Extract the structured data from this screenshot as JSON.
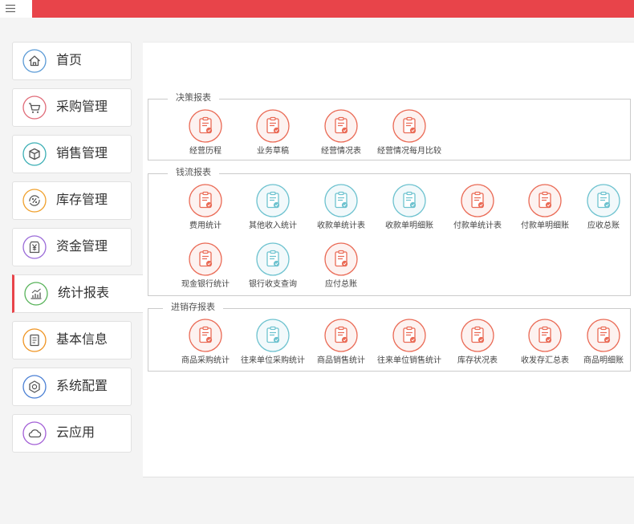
{
  "menu_button": {
    "icon": "hamburger-icon"
  },
  "header": {
    "accent_color": "#e8444a"
  },
  "sidebar": {
    "items": [
      {
        "label": "首页",
        "icon": "home-icon",
        "color": "#5a9ad6"
      },
      {
        "label": "采购管理",
        "icon": "cart-icon",
        "color": "#e06b78"
      },
      {
        "label": "销售管理",
        "icon": "box-icon",
        "color": "#3aaeb4"
      },
      {
        "label": "库存管理",
        "icon": "inventory-percent-icon",
        "color": "#f0a12e"
      },
      {
        "label": "资金管理",
        "icon": "yen-icon",
        "color": "#9a6ad8"
      },
      {
        "label": "统计报表",
        "icon": "bar-chart-icon",
        "color": "#58b35a",
        "active": true
      },
      {
        "label": "基本信息",
        "icon": "document-icon",
        "color": "#ef9422"
      },
      {
        "label": "系统配置",
        "icon": "hexagon-gear-icon",
        "color": "#4a7fd4"
      },
      {
        "label": "云应用",
        "icon": "cloud-icon",
        "color": "#a25ed6"
      }
    ]
  },
  "reports": {
    "groups": [
      {
        "title": "决策报表",
        "rows": [
          [
            {
              "label": "经营历程",
              "icon": "report-icon",
              "color": "#ea6a55"
            },
            {
              "label": "业务草稿",
              "icon": "report-icon",
              "color": "#ea6a55"
            },
            {
              "label": "经营情况表",
              "icon": "report-icon",
              "color": "#ea6a55"
            },
            {
              "label": "经营情况每月比较",
              "icon": "report-icon",
              "color": "#ea6a55"
            }
          ]
        ]
      },
      {
        "title": "钱流报表",
        "rows": [
          [
            {
              "label": "费用统计",
              "icon": "report-icon",
              "color": "#ea6a55"
            },
            {
              "label": "其他收入统计",
              "icon": "report-icon",
              "color": "#6dc2cf"
            },
            {
              "label": "收款单统计表",
              "icon": "report-icon",
              "color": "#6dc2cf"
            },
            {
              "label": "收款单明细账",
              "icon": "report-icon",
              "color": "#6dc2cf"
            },
            {
              "label": "付款单统计表",
              "icon": "report-icon",
              "color": "#ea6a55"
            },
            {
              "label": "付款单明细账",
              "icon": "report-icon",
              "color": "#ea6a55"
            },
            {
              "label": "应收总账",
              "icon": "report-icon",
              "color": "#6dc2cf"
            }
          ],
          [
            {
              "label": "现金银行统计",
              "icon": "report-icon",
              "color": "#ea6a55"
            },
            {
              "label": "银行收支查询",
              "icon": "report-icon",
              "color": "#6dc2cf"
            },
            {
              "label": "应付总账",
              "icon": "report-icon",
              "color": "#ea6a55"
            }
          ]
        ]
      },
      {
        "title": "进销存报表",
        "rows": [
          [
            {
              "label": "商品采购统计",
              "icon": "report-icon",
              "color": "#ea6a55"
            },
            {
              "label": "往来单位采购统计",
              "icon": "report-icon",
              "color": "#6dc2cf"
            },
            {
              "label": "商品销售统计",
              "icon": "report-icon",
              "color": "#ea6a55"
            },
            {
              "label": "往来单位销售统计",
              "icon": "report-icon",
              "color": "#ea6a55"
            },
            {
              "label": "库存状况表",
              "icon": "report-icon",
              "color": "#ea6a55"
            },
            {
              "label": "收发存汇总表",
              "icon": "report-icon",
              "color": "#ea6a55"
            },
            {
              "label": "商品明细账",
              "icon": "report-icon",
              "color": "#ea6a55"
            }
          ]
        ]
      }
    ]
  }
}
